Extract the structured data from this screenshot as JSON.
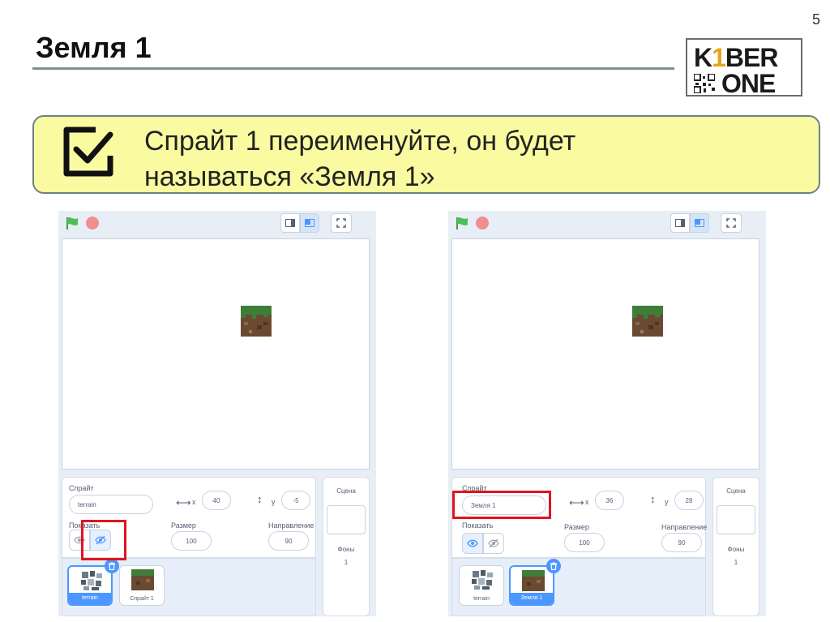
{
  "slide": {
    "page_number": "5",
    "title": "Земля 1",
    "instruction": "Спрайт 1 переименуйте, он будет называться «Земля 1»"
  },
  "logo": {
    "top_k": "K",
    "top_one": "1",
    "top_rest": "BER",
    "bottom": "ONE"
  },
  "colors": {
    "callout_bg": "#fafaa0",
    "highlight": "#e0141e",
    "scratch_blue": "#4c97ff"
  },
  "left_panel": {
    "sprite_label": "Спрайт",
    "sprite_name": "terrain",
    "x_label": "x",
    "x_value": "40",
    "y_label": "y",
    "y_value": "-5",
    "show_label": "Показать",
    "size_label": "Размер",
    "size_value": "100",
    "direction_label": "Направление",
    "direction_value": "90",
    "stage_label": "Сцена",
    "backdrops_label": "Фоны",
    "backdrops_count": "1",
    "sprites": [
      {
        "name": "terrain",
        "selected": true
      },
      {
        "name": "Спрайт 1",
        "selected": false
      }
    ]
  },
  "right_panel": {
    "sprite_label": "Спрайт",
    "sprite_name": "Земля 1",
    "x_label": "x",
    "x_value": "36",
    "y_label": "y",
    "y_value": "28",
    "show_label": "Показать",
    "size_label": "Размер",
    "size_value": "100",
    "direction_label": "Направление",
    "direction_value": "90",
    "stage_label": "Сцена",
    "backdrops_label": "Фоны",
    "backdrops_count": "1",
    "sprites": [
      {
        "name": "terrain",
        "selected": false
      },
      {
        "name": "Земля 1",
        "selected": true
      }
    ]
  }
}
